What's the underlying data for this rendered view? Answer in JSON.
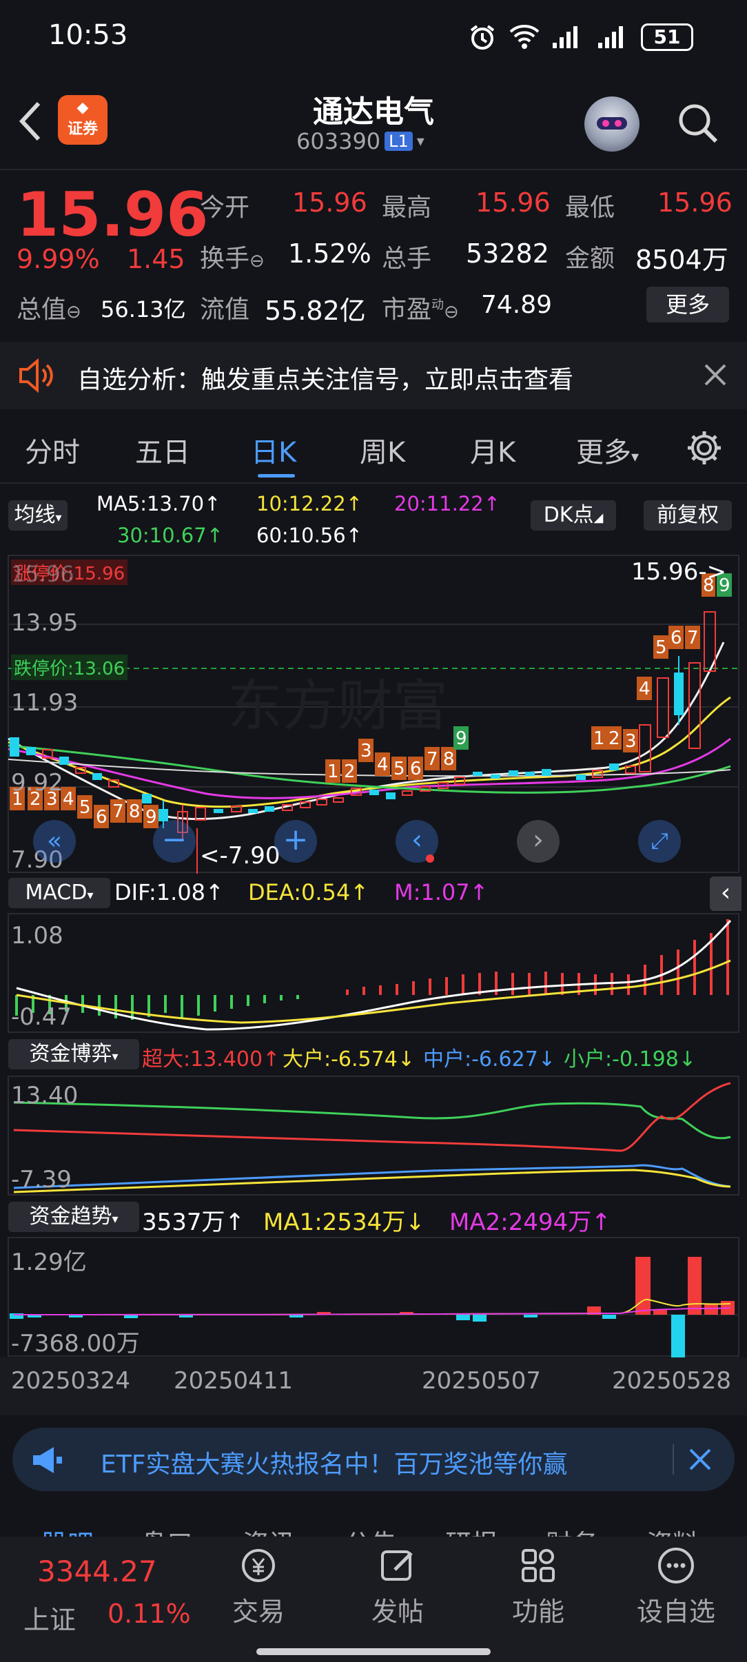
{
  "status_bar": {
    "time": "10:53",
    "battery": "51"
  },
  "header": {
    "title": "通达电气",
    "code": "603390",
    "level": "L1",
    "app_badge": "证券"
  },
  "quote": {
    "price": "15.96",
    "change_pct": "9.99%",
    "change": "1.45",
    "open_label": "今开",
    "open": "15.96",
    "high_label": "最高",
    "high": "15.96",
    "low_label": "最低",
    "low": "15.96",
    "turnover_label": "换手",
    "turnover": "1.52%",
    "volume_label": "总手",
    "volume": "53282",
    "amount_label": "金额",
    "amount": "8504万",
    "mcap_label": "总值",
    "mcap": "56.13亿",
    "float_label": "流值",
    "float_mcap": "55.82亿",
    "pe_label": "市盈",
    "pe_sup": "动",
    "pe": "74.89",
    "more": "更多"
  },
  "notice": {
    "text": "自选分析：触发重点关注信号，立即点击查看"
  },
  "tabs": [
    "分时",
    "五日",
    "日K",
    "周K",
    "月K",
    "更多"
  ],
  "active_tab": 2,
  "ma_bar": {
    "selector": "均线",
    "ma5": "MA5:13.70↑",
    "ma10": "10:12.22↑",
    "ma20": "20:11.22↑",
    "ma30": "30:10.67↑",
    "ma60": "60:10.56↑",
    "dk": "DK点",
    "adjust": "前复权"
  },
  "kchart": {
    "limit_up": "涨停价:15.96",
    "limit_down": "跌停价:13.06",
    "axis": [
      "15.96",
      "13.95",
      "11.93",
      "9.92",
      "7.90"
    ],
    "last_label": "15.96->",
    "low_marker": "<-7.90",
    "watermark": "东方财富"
  },
  "macd": {
    "name": "MACD",
    "dif": "DIF:1.08↑",
    "dea": "DEA:0.54↑",
    "m": "M:1.07↑",
    "axis_top": "1.08",
    "axis_bot": "-0.47"
  },
  "fund_game": {
    "name": "资金博弈",
    "super": "超大:13.400↑",
    "big": "大户:-6.574↓",
    "mid": "中户:-6.627↓",
    "small": "小户:-0.198↓",
    "axis_top": "13.40",
    "axis_bot": "-7.39"
  },
  "fund_trend": {
    "name": "资金趋势",
    "value": "3537万↑",
    "ma1": "MA1:2534万↓",
    "ma2": "MA2:2494万↑",
    "axis_top": "1.29亿",
    "axis_bot": "-7368.00万"
  },
  "dates": [
    "20250324",
    "20250411",
    "20250507",
    "20250528"
  ],
  "banner": {
    "text": "ETF实盘大赛火热报名中！百万奖池等你赢"
  },
  "bottom_nav": {
    "index_value": "3344.27",
    "index_name": "上证",
    "index_change": "0.11%",
    "items": [
      "交易",
      "发帖",
      "功能",
      "设自选"
    ],
    "peek_tabs": [
      "股吧",
      "盘口",
      "资讯",
      "公告",
      "研报",
      "财务",
      "资料"
    ]
  },
  "colors": {
    "up": "#f23b3b",
    "down": "#22d3ee",
    "bg": "#131419",
    "accent": "#4d9cff"
  }
}
